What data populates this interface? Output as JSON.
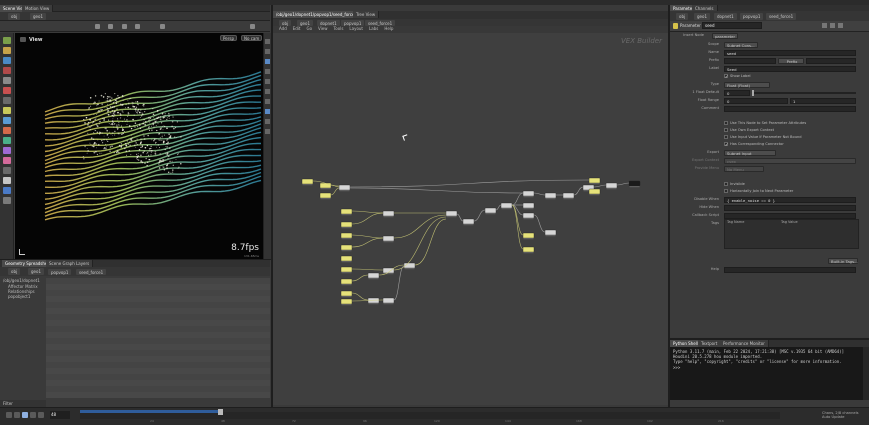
{
  "left_pane": {
    "tabs": [
      "Scene View",
      "Motion View",
      "Geometry Spreadsheet",
      "Render View"
    ],
    "path": [
      "obj",
      "geo1"
    ],
    "viewport": {
      "label": "View",
      "persp": "Persp",
      "camera": "No cam",
      "fps": "8.7fps",
      "fps_sub": "131.65ms"
    }
  },
  "lower_pane": {
    "tabs": [
      "Geometry Spreadsheet",
      "Scene Graph Layers"
    ],
    "path": [
      "obj",
      "geo1",
      "popvop1",
      "seed_force1"
    ],
    "tree": [
      "/obj/geo1/dopnet1",
      "Affector Matrix",
      "Relationships",
      "popobject1"
    ],
    "filter": "Filter"
  },
  "network": {
    "tabs": [
      "/obj/geo1/dopnet1/popvop1/seed_force1",
      "Tree View"
    ],
    "path": [
      "obj",
      "geo1",
      "dopnet1",
      "popvop1",
      "seed_force1"
    ],
    "menu": [
      "Add",
      "Edit",
      "Go",
      "View",
      "Tools",
      "Layout",
      "Labs",
      "Help"
    ],
    "title": "VEX Builder"
  },
  "params": {
    "tabs": [
      "Parameters",
      "Channels"
    ],
    "path": [
      "obj",
      "geo1",
      "dopnet1",
      "popvop1",
      "seed_force1"
    ],
    "node_type": "Parameter",
    "node_name": "seed",
    "insert_label": "Insert Node",
    "insert_value": "parameter",
    "rows": {
      "scope": {
        "label": "Scope",
        "value": "Subnet Cons..."
      },
      "name": {
        "label": "Name",
        "value": "seed"
      },
      "prefix": {
        "label": "Prefix",
        "value": "",
        "btn": "Prefix"
      },
      "label": {
        "label": "Label",
        "value": "Seed"
      },
      "show_label": "Show Label",
      "type": {
        "label": "Type",
        "value": "Float (Float)"
      },
      "default": {
        "label": "1 Float Default",
        "value": "0"
      },
      "range": {
        "label": "Float Range",
        "min": "0",
        "max": "1"
      },
      "comment": {
        "label": "Comment",
        "value": ""
      },
      "checks": [
        {
          "text": "Use This Node to Set Parameter Attributes",
          "checked": false
        },
        {
          "text": "Use Own Export Context",
          "checked": false
        },
        {
          "text": "Use Input Value If Parameter Not Bound",
          "checked": false
        },
        {
          "text": "Has Corresponding Connector",
          "checked": true
        }
      ],
      "export": {
        "label": "Export",
        "value": "Subnet Input"
      },
      "export_ctx": {
        "label": "Export Context",
        "value": "cvex"
      },
      "provide_menu": {
        "label": "Provide Menu",
        "value": "No Menu"
      },
      "invisible": "Invisible",
      "join_next": "Horizontally Join to Next Parameter",
      "disable_when": {
        "label": "Disable When",
        "value": "{ enable_noise == 0 }"
      },
      "hide_when": {
        "label": "Hide When",
        "value": ""
      },
      "callback": {
        "label": "Callback Script",
        "value": ""
      },
      "tags": {
        "label": "Tags",
        "col1": "Tag Name",
        "col2": "Tag Value",
        "btn": "Built-in Tags..."
      },
      "help": {
        "label": "Help",
        "value": ""
      }
    }
  },
  "python": {
    "tabs": [
      "Python Shell",
      "Textport",
      "Performance Monitor"
    ],
    "lines": [
      "Python 3.11.7 (main, Feb 22 2024, 17:21:38) [MSC v.1935 64 bit (AMD64)]",
      "Houdini 20.5.278 hou module imported.",
      "Type \"help\", \"copyright\", \"credits\" or \"license\" for more information.",
      ">>>"
    ]
  },
  "timeline": {
    "frame": "48",
    "ticks": [
      "24",
      "48",
      "72",
      "96",
      "120",
      "144",
      "168",
      "192",
      "216"
    ],
    "range_end": "240"
  },
  "status": {
    "line1": "Chans, 2/8 channels",
    "line2": "Auto Update"
  },
  "colors": {
    "accent_blue": "#2f5d9b",
    "node_yellow": "#e6e27a",
    "node_grey": "#d6d6d6",
    "wire_yellow": "#d4d27a",
    "wire_grey": "#b0b0b0"
  }
}
